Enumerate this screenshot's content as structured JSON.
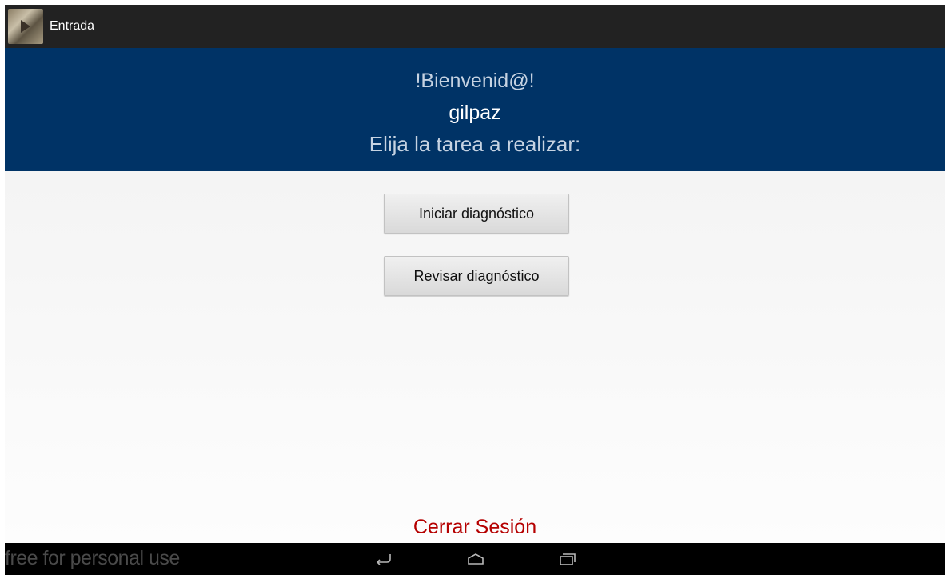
{
  "action_bar": {
    "title": "Entrada",
    "icon": "app-logo-icon"
  },
  "header": {
    "welcome": "!Bienvenid@!",
    "username": "gilpaz",
    "instruction": "Elija la tarea a realizar:"
  },
  "actions": {
    "start_label": "Iniciar diagnóstico",
    "review_label": "Revisar diagnóstico",
    "logout_label": "Cerrar Sesión"
  },
  "nav_bar": {
    "watermark": "free for personal use",
    "back_icon": "back-icon",
    "home_icon": "home-icon",
    "recent_icon": "recent-apps-icon"
  },
  "colors": {
    "header_bg": "#003366",
    "action_bar_bg": "#222222",
    "logout_text": "#b50000",
    "nav_bar_bg": "#000000"
  }
}
